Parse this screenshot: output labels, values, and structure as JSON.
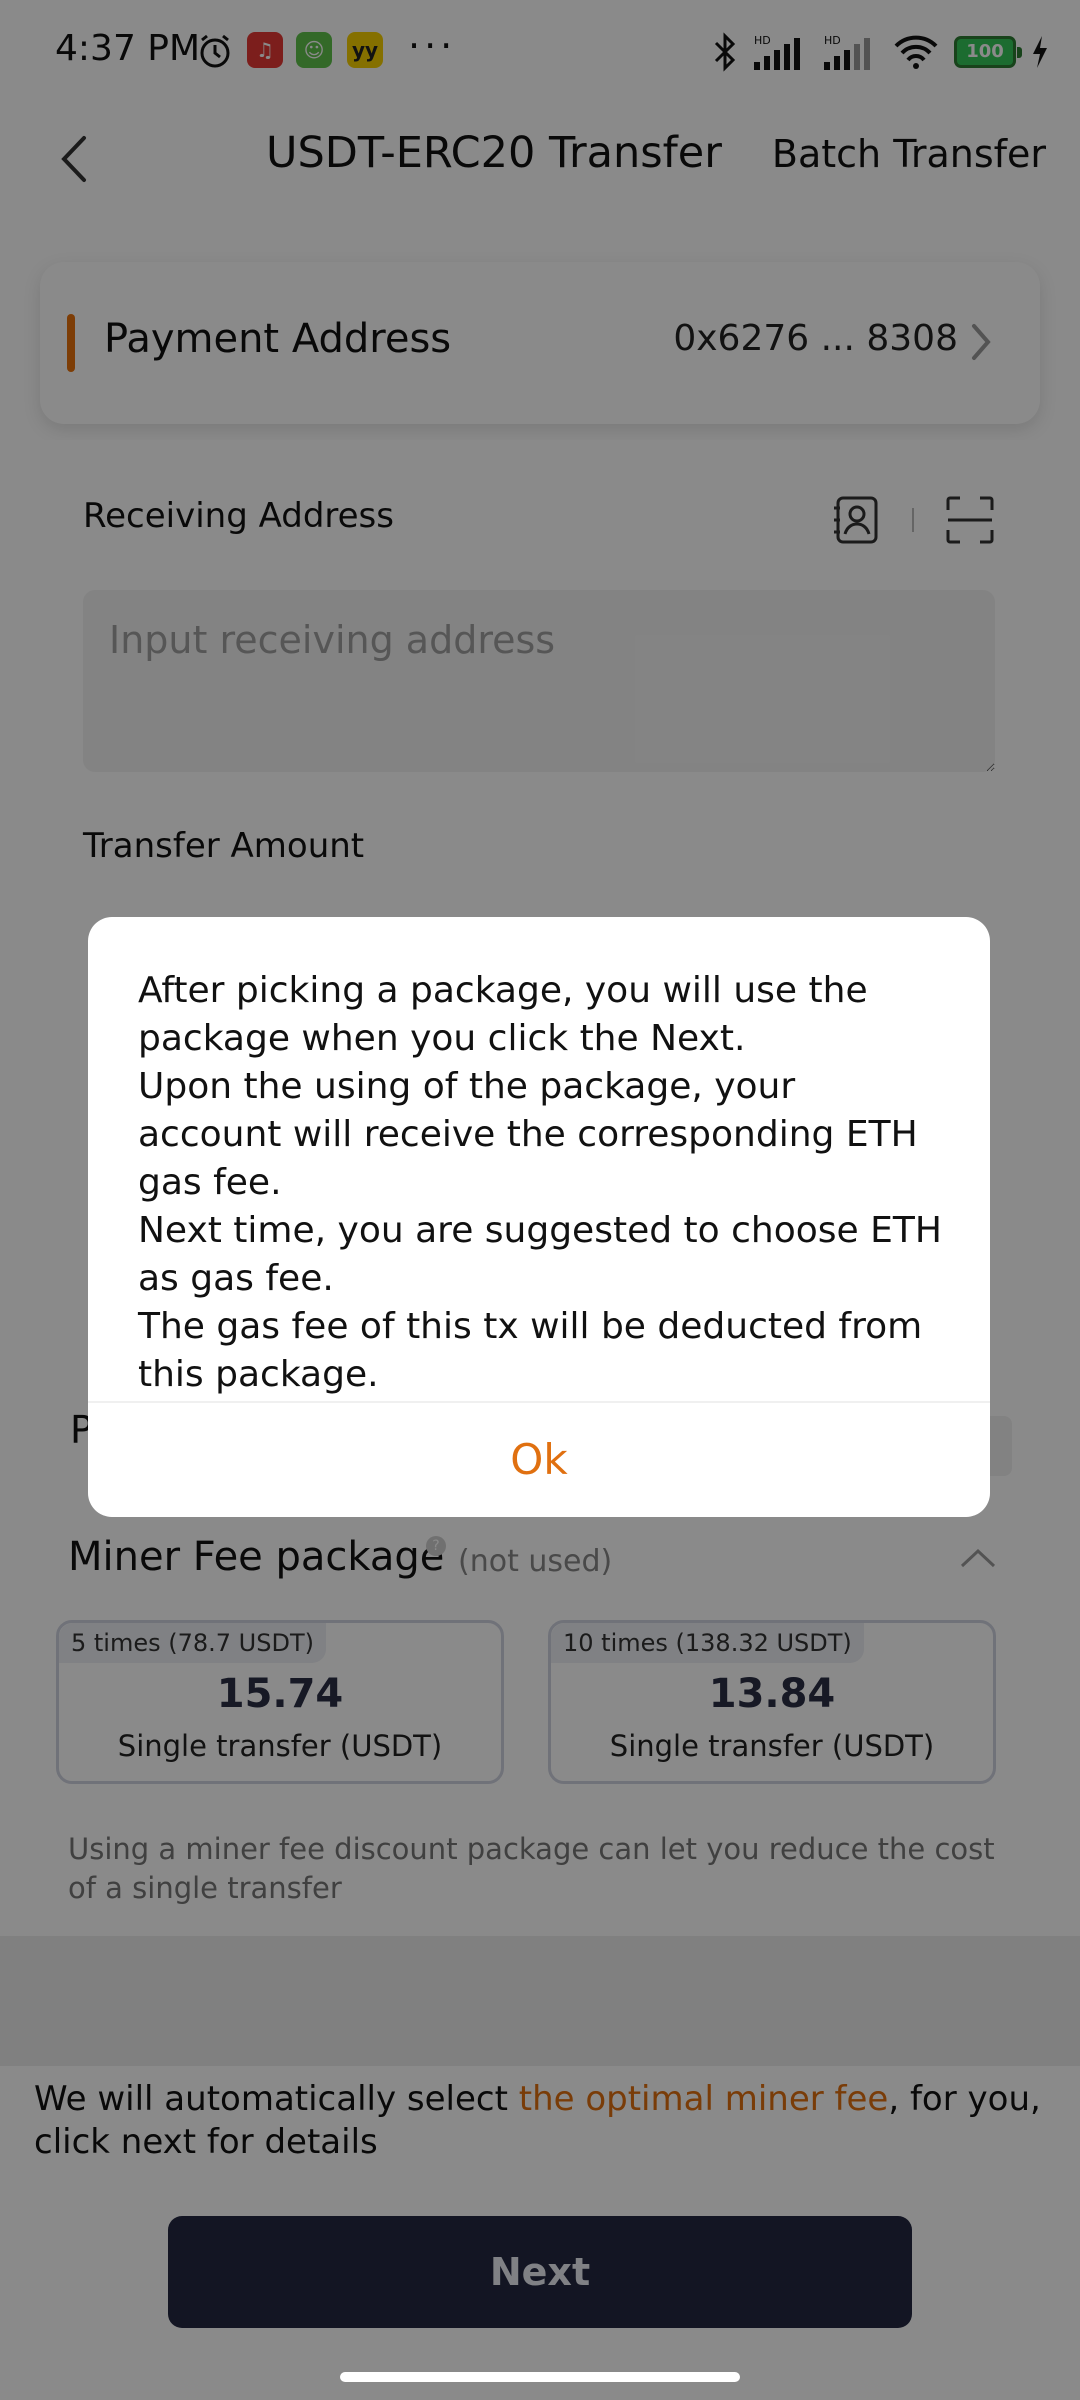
{
  "status_bar": {
    "time": "4:37 PM",
    "battery": "100",
    "more": "···"
  },
  "header": {
    "title": "USDT-ERC20 Transfer",
    "batch_transfer": "Batch Transfer"
  },
  "payment": {
    "label": "Payment Address",
    "address": "0x6276 ... 8308"
  },
  "receiving": {
    "label": "Receiving Address",
    "placeholder": "Input receiving address"
  },
  "transfer_amount": {
    "label": "Transfer Amount"
  },
  "partial_row_letter": "P",
  "miner_fee_package": {
    "title": "Miner Fee package",
    "info": "?",
    "status": "(not used)",
    "packages": [
      {
        "tag": "5 times (78.7 USDT)",
        "price": "15.74",
        "sub": "Single transfer (USDT)"
      },
      {
        "tag": "10 times (138.32 USDT)",
        "price": "13.84",
        "sub": "Single transfer (USDT)"
      }
    ],
    "hint": "Using a miner fee discount package can let you reduce the cost of a single transfer"
  },
  "auto_select": {
    "prefix": "We will automatically select ",
    "highlight": "the optimal miner fee",
    "suffix": ", for you, click next for details"
  },
  "next_button": "Next",
  "modal": {
    "lines": [
      "After picking a package, you will use the package when you click the Next.",
      "Upon the using of the package, your account will receive the corresponding ETH gas fee.",
      "Next time, you are suggested to choose ETH as gas fee.",
      "The gas fee of this tx will be deducted from this package."
    ],
    "ok": "Ok"
  },
  "colors": {
    "accent": "#e07010",
    "button": "#232842",
    "overlay": "rgba(0,0,0,0.46)"
  },
  "icons": {
    "back": "back-arrow-icon",
    "contacts": "contact-book-icon",
    "scan": "scan-icon",
    "chevron_right": "chevron-right-icon",
    "chevron_up": "chevron-up-icon"
  }
}
